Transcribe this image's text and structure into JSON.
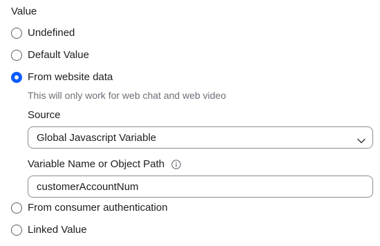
{
  "section": {
    "title": "Value"
  },
  "options": {
    "undefined": "Undefined",
    "default_value": "Default Value",
    "from_website_data": "From website data",
    "from_consumer_auth": "From consumer authentication",
    "linked_value": "Linked Value"
  },
  "selected_option": "From website data",
  "website_data": {
    "helper_text": "This will only work for web chat and web video",
    "source_label": "Source",
    "source_value": "Global Javascript Variable",
    "variable_label": "Variable Name or Object Path",
    "variable_value": "customerAccountNum"
  },
  "colors": {
    "accent": "#0b5cff",
    "text": "#1d1d1f",
    "muted": "#6e6e78",
    "border": "#8a8a94"
  }
}
